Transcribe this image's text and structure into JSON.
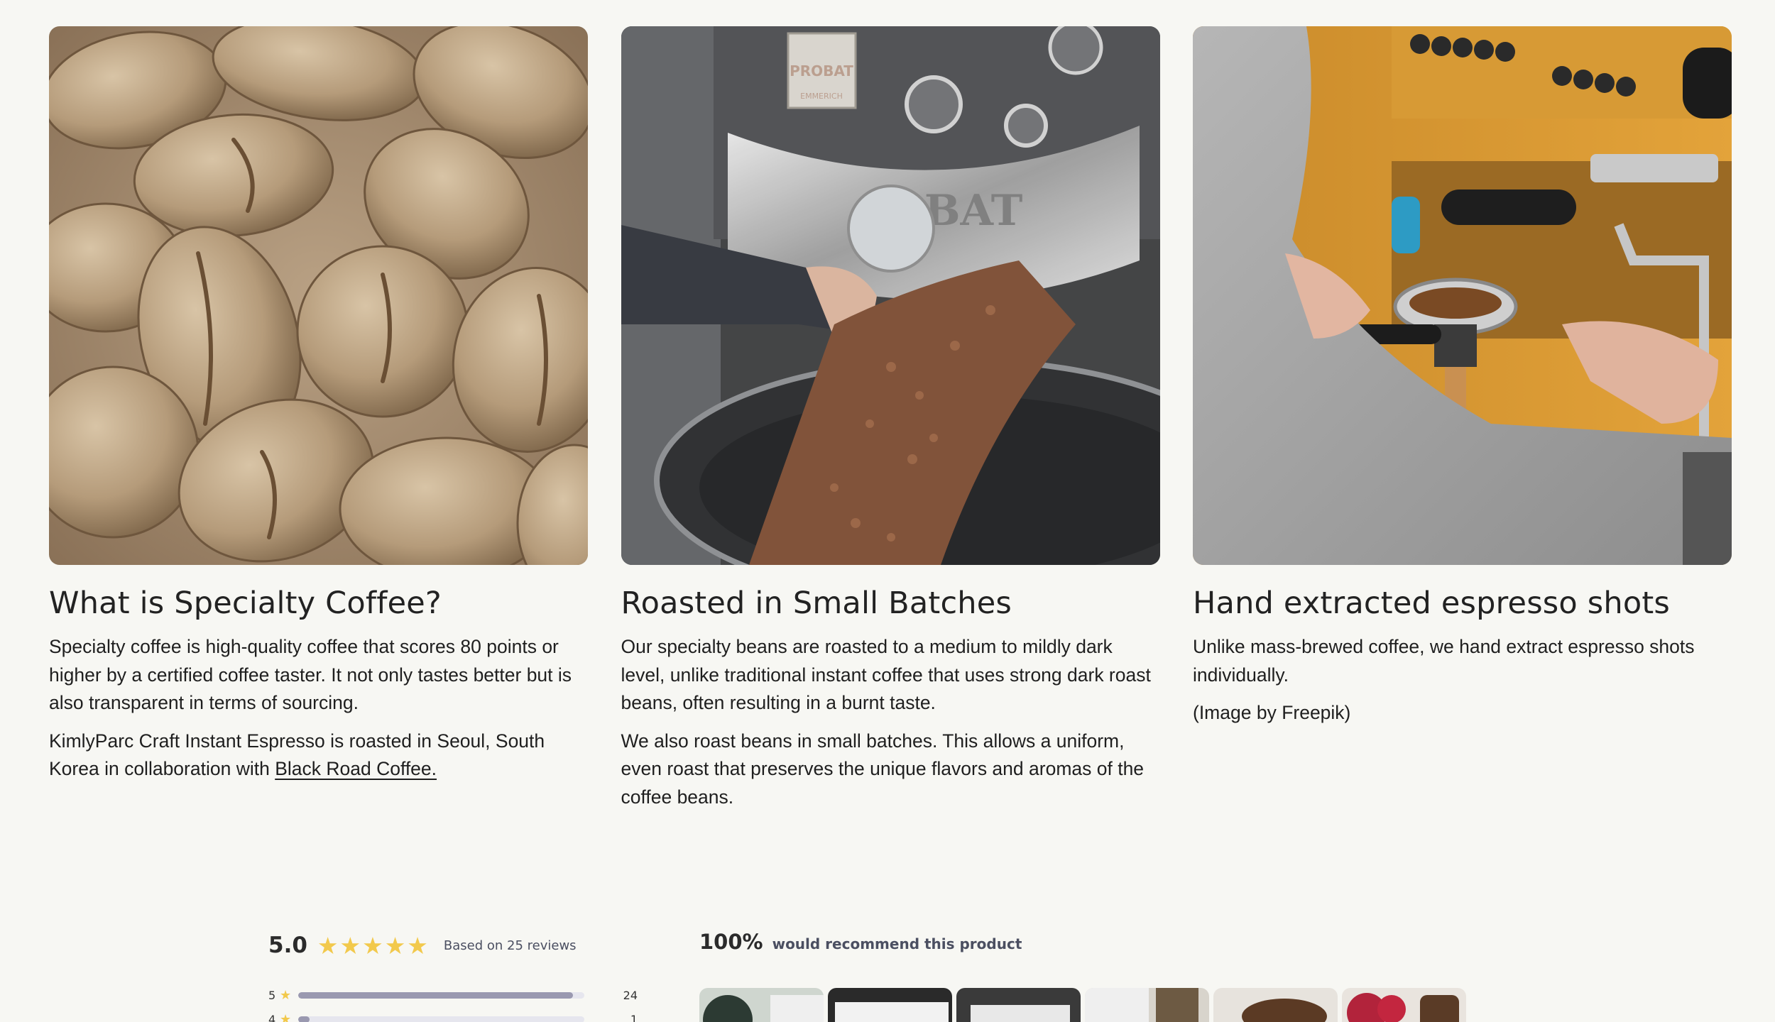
{
  "cards": [
    {
      "title": "What is Specialty Coffee?",
      "paragraphs": [
        "Specialty coffee is high-quality coffee that scores 80 points or higher by a certified coffee taster. It not only tastes better but is also transparent in terms of sourcing.",
        "KimlyParc Craft Instant Espresso is roasted in Seoul, South Korea in collaboration with "
      ],
      "link_text": "Black Road Coffee.",
      "image_icon": "green-coffee-beans-photo"
    },
    {
      "title": "Roasted in Small Batches",
      "paragraphs": [
        "Our specialty beans are roasted to a medium to mildly dark level, unlike traditional instant coffee that uses strong dark roast beans, often resulting in a burnt taste.",
        "We also roast beans in small batches. This allows a uniform, even roast that preserves the unique flavors and aromas of the coffee beans."
      ],
      "image_icon": "coffee-roaster-photo",
      "image_text": {
        "brand": "PROBAT",
        "sub": "EMMERICH",
        "drum": "OBAT"
      }
    },
    {
      "title": "Hand extracted espresso shots",
      "paragraphs": [
        "Unlike mass-brewed coffee, we hand extract espresso shots individually.",
        "(Image by Freepik)"
      ],
      "image_icon": "espresso-machine-photo"
    }
  ],
  "reviews": {
    "average": "5.0",
    "stars": 5,
    "based_on": "Based on 25 reviews",
    "breakdown": [
      {
        "stars": "5",
        "count": "24",
        "fraction": 0.96
      },
      {
        "stars": "4",
        "count": "1",
        "fraction": 0.04
      }
    ],
    "recommend_pct": "100%",
    "recommend_text": "would recommend this product",
    "thumbnails": [
      "review-photo-1",
      "review-photo-2",
      "review-photo-3",
      "review-photo-4",
      "review-photo-5",
      "review-photo-6"
    ]
  },
  "colors": {
    "background": "#f7f7f3",
    "star": "#f2c94c",
    "bar": "#9a99b0"
  }
}
